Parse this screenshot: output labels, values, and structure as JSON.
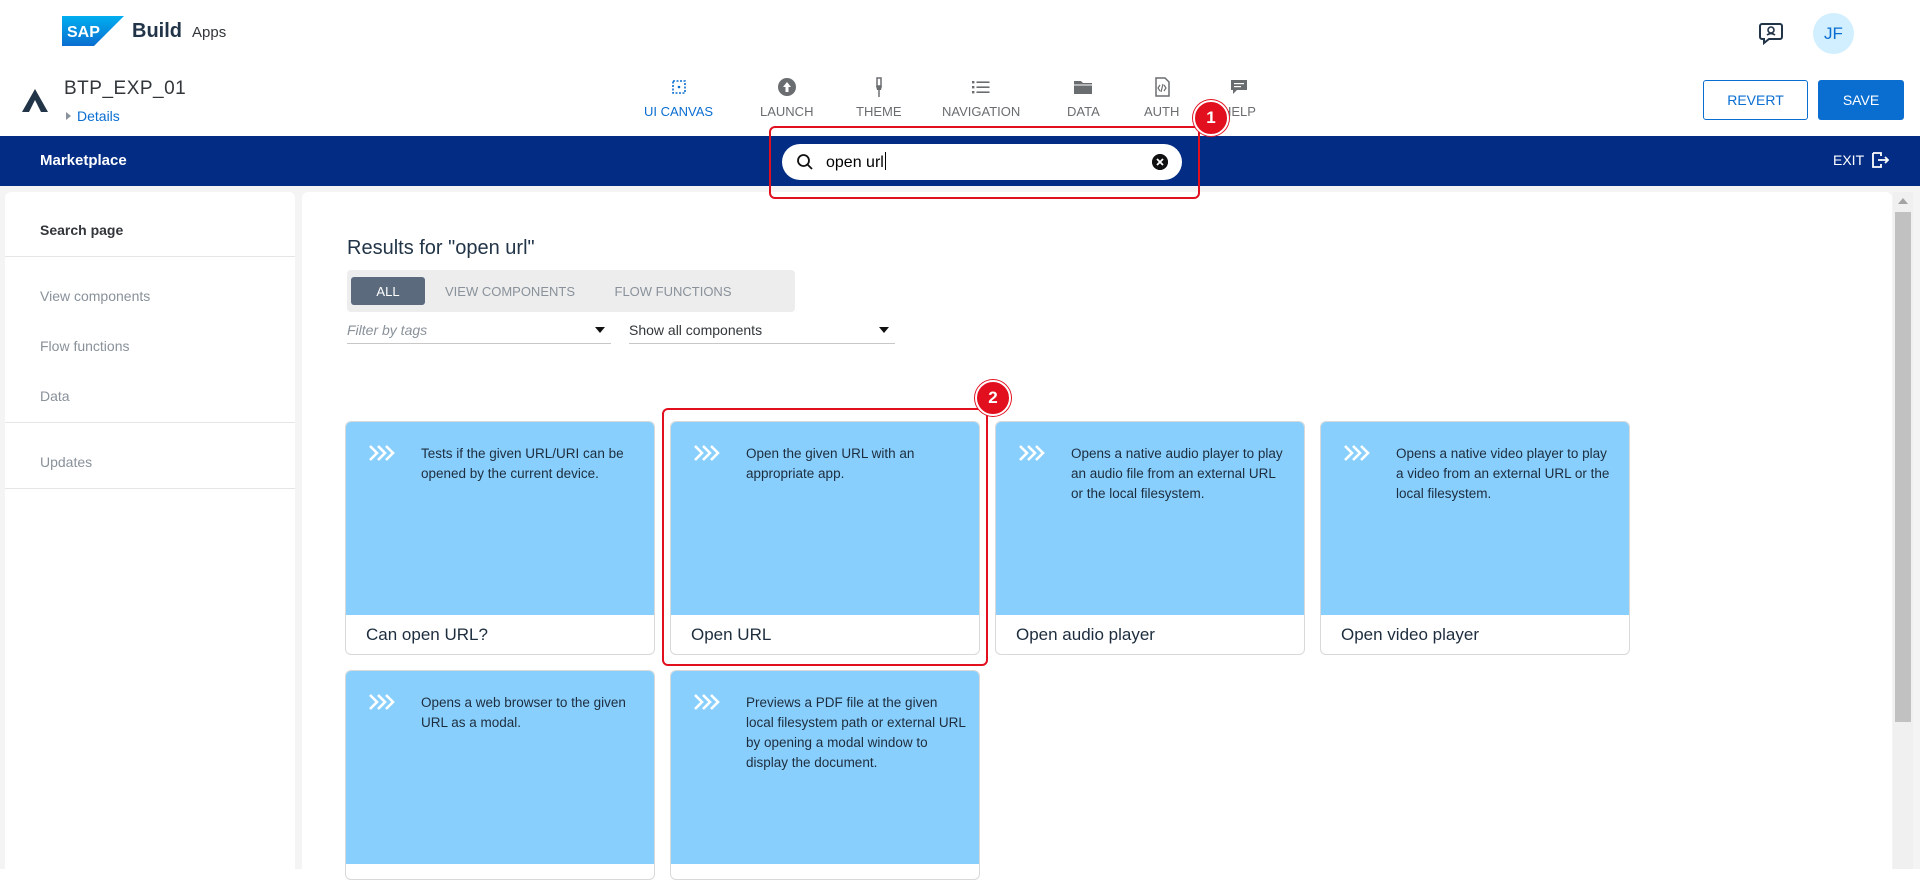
{
  "brand": {
    "product": "Build",
    "subproduct": "Apps",
    "user_initials": "JF"
  },
  "app": {
    "name": "BTP_EXP_01",
    "details_link": "Details"
  },
  "nav_tabs": [
    {
      "label": "UI CANVAS",
      "icon": "canvas-icon",
      "active": true
    },
    {
      "label": "LAUNCH",
      "icon": "launch-icon"
    },
    {
      "label": "THEME",
      "icon": "brush-icon"
    },
    {
      "label": "NAVIGATION",
      "icon": "list-icon"
    },
    {
      "label": "DATA",
      "icon": "folder-icon"
    },
    {
      "label": "AUTH",
      "icon": "document-code-icon"
    },
    {
      "label": "HELP",
      "icon": "chat-bubble-icon"
    }
  ],
  "actions": {
    "revert": "REVERT",
    "save": "SAVE"
  },
  "marketplace": {
    "title": "Marketplace",
    "search_value": "open url",
    "exit": "EXIT"
  },
  "sidebar": {
    "items": [
      {
        "label": "Search page"
      },
      {
        "label": "View components"
      },
      {
        "label": "Flow functions"
      },
      {
        "label": "Data"
      },
      {
        "label": "Updates"
      }
    ]
  },
  "results": {
    "title": "Results for \"open url\"",
    "filters": {
      "all": "ALL",
      "view_components": "VIEW COMPONENTS",
      "flow_functions": "FLOW FUNCTIONS",
      "active": "all"
    },
    "tags_placeholder": "Filter by tags",
    "components_select": "Show all components",
    "cards": [
      {
        "title": "Can open URL?",
        "description": "Tests if the given URL/URI can be opened by the current device."
      },
      {
        "title": "Open URL",
        "description": "Open the given URL with an appropriate app."
      },
      {
        "title": "Open audio player",
        "description": "Opens a native audio player to play an audio file from an external URL or the local filesystem."
      },
      {
        "title": "Open video player",
        "description": "Opens a native video player to play a video from an external URL or the local filesystem."
      },
      {
        "title": "",
        "description": "Opens a web browser to the given URL as a modal."
      },
      {
        "title": "",
        "description": "Previews a PDF file at the given local filesystem path or external URL by opening a modal window to display the document."
      }
    ]
  },
  "annotations": [
    {
      "label": "1"
    },
    {
      "label": "2"
    }
  ],
  "colors": {
    "brand_blue": "#0a6ed1",
    "marketplace_bar": "#032d85",
    "card_top": "#89cffd",
    "annotation_red": "#e2101f"
  }
}
